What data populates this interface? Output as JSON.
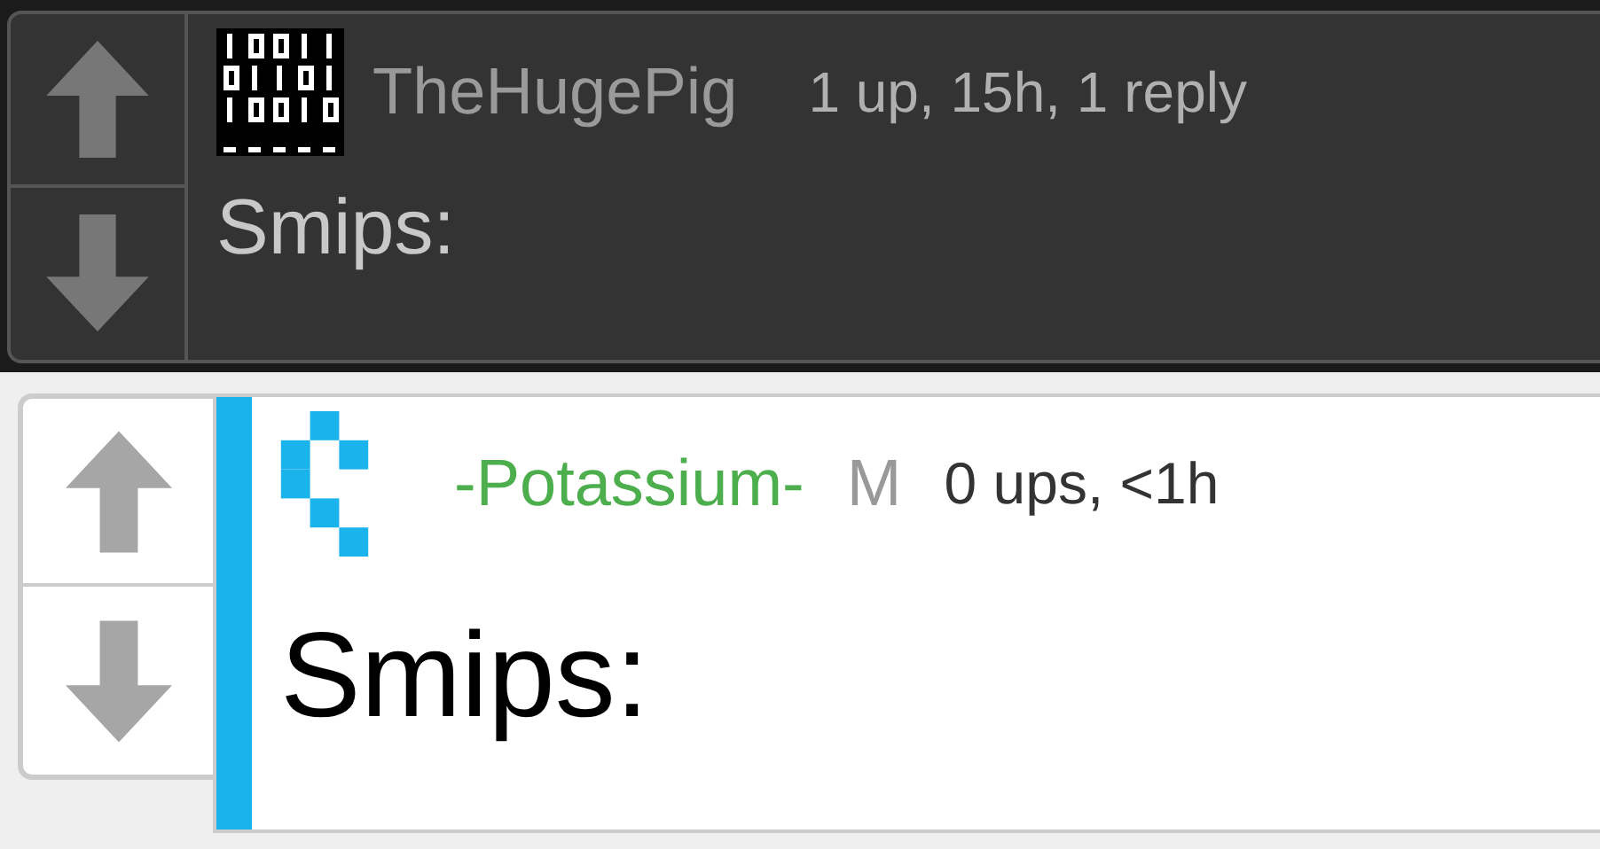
{
  "comments": [
    {
      "kind": "dark",
      "avatar": {
        "kind": "binary"
      },
      "username": {
        "text": "TheHugePig",
        "color": "#9a9a9a"
      },
      "meta": "1 up, 15h, 1 reply",
      "text": "Smips:",
      "highlighted": false
    },
    {
      "kind": "light",
      "avatar": {
        "kind": "pixel"
      },
      "username": {
        "text": "-Potassium-",
        "color": "#4cae4c"
      },
      "badge": "M",
      "meta": "0 ups, <1h",
      "text": "Smips:",
      "highlighted": true
    }
  ]
}
